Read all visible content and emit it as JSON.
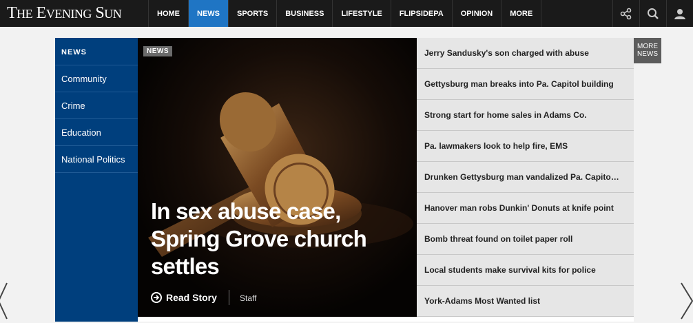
{
  "header": {
    "logo": "THE EVENING SUN",
    "nav": [
      "HOME",
      "NEWS",
      "SPORTS",
      "BUSINESS",
      "LIFESTYLE",
      "FLIPSIDEPA",
      "OPINION",
      "MORE"
    ],
    "icons": [
      "share-icon",
      "search-icon",
      "user-icon"
    ]
  },
  "sidebar": {
    "title": "NEWS",
    "items": [
      "Community",
      "Crime",
      "Education",
      "National Politics"
    ]
  },
  "hero": {
    "tag": "NEWS",
    "title": "In sex abuse case, Spring Grove church settles",
    "read_label": "Read Story",
    "author": "Staff"
  },
  "headlines": [
    "Jerry Sandusky's son charged with abuse",
    "Gettysburg man breaks into Pa. Capitol building",
    "Strong start for home sales in Adams Co.",
    "Pa. lawmakers look to help fire, EMS",
    "Drunken Gettysburg man vandalized Pa. Capitol, police say",
    "Hanover man robs Dunkin' Donuts at knife point",
    "Bomb threat found on toilet paper roll",
    "Local students make survival kits for police",
    "York-Adams Most Wanted list"
  ],
  "more_news": {
    "line1": "MORE",
    "line2": "NEWS"
  },
  "colors": {
    "nav_active": "#1f75c4",
    "sidebar": "#003f7d",
    "topbar": "#1a1a1a"
  }
}
